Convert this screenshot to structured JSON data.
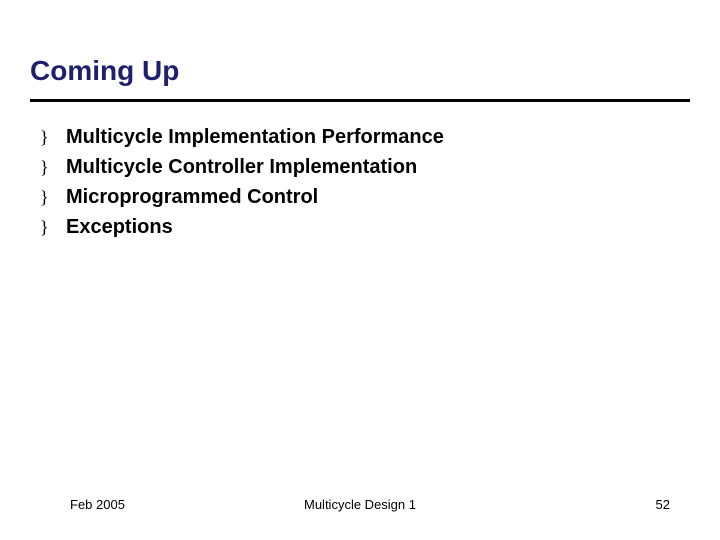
{
  "title": "Coming Up",
  "bullets": [
    {
      "marker": "}",
      "text": "Multicycle Implementation Performance"
    },
    {
      "marker": "}",
      "text": "Multicycle Controller Implementation"
    },
    {
      "marker": "}",
      "text": "Microprogrammed Control"
    },
    {
      "marker": "}",
      "text": "Exceptions"
    }
  ],
  "footer": {
    "left": "Feb 2005",
    "center": "Multicycle Design 1",
    "right": "52"
  }
}
